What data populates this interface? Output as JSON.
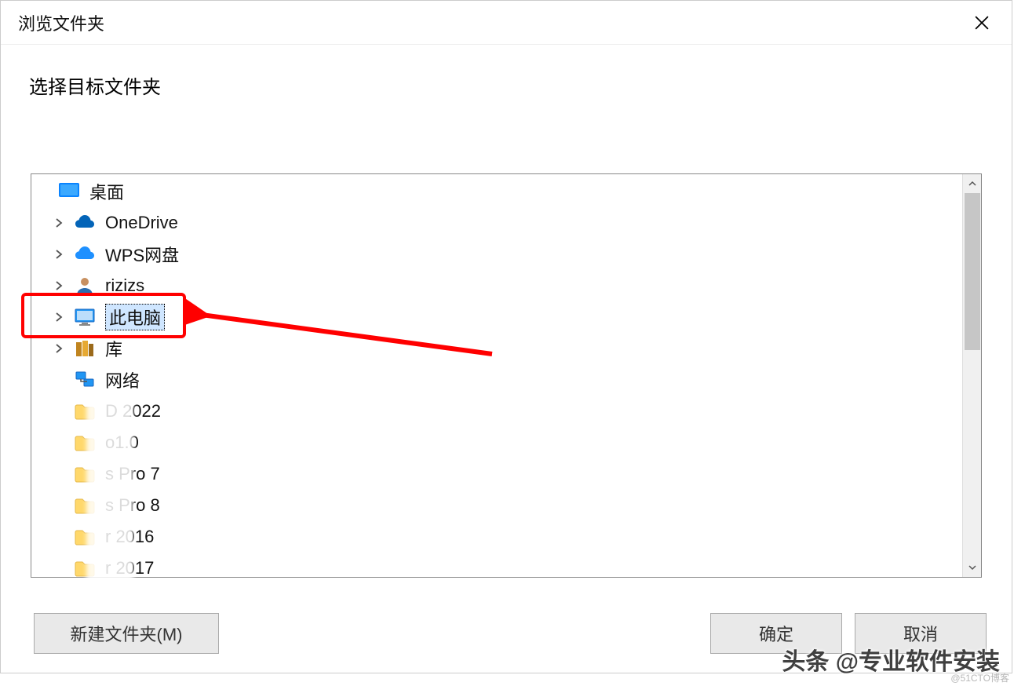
{
  "dialog": {
    "title": "浏览文件夹",
    "instruction": "选择目标文件夹"
  },
  "tree": {
    "items": [
      {
        "label": "桌面",
        "icon": "desktop-blue",
        "level": 0,
        "expandable": false,
        "selected": false
      },
      {
        "label": "OneDrive",
        "icon": "onedrive",
        "level": 1,
        "expandable": true,
        "selected": false
      },
      {
        "label": "WPS网盘",
        "icon": "wps-cloud",
        "level": 1,
        "expandable": true,
        "selected": false
      },
      {
        "label": "rizizs",
        "icon": "user",
        "level": 1,
        "expandable": true,
        "selected": false
      },
      {
        "label": "此电脑",
        "icon": "this-pc",
        "level": 1,
        "expandable": true,
        "selected": true
      },
      {
        "label": "库",
        "icon": "libraries",
        "level": 1,
        "expandable": true,
        "selected": false
      },
      {
        "label": "网络",
        "icon": "network",
        "level": 1,
        "expandable": false,
        "selected": false
      },
      {
        "label": "D 2022",
        "icon": "folder",
        "level": 1,
        "expandable": false,
        "selected": false,
        "blurred": true
      },
      {
        "label": "o1.0",
        "icon": "folder",
        "level": 1,
        "expandable": false,
        "selected": false,
        "blurred": true
      },
      {
        "label": "s Pro 7",
        "icon": "folder",
        "level": 1,
        "expandable": false,
        "selected": false,
        "blurred": true
      },
      {
        "label": "s Pro 8",
        "icon": "folder",
        "level": 1,
        "expandable": false,
        "selected": false,
        "blurred": true
      },
      {
        "label": "r 2016",
        "icon": "folder",
        "level": 1,
        "expandable": false,
        "selected": false,
        "blurred": true
      },
      {
        "label": "r 2017",
        "icon": "folder",
        "level": 1,
        "expandable": false,
        "selected": false,
        "blurred": true
      }
    ]
  },
  "buttons": {
    "new_folder": "新建文件夹(M)",
    "ok": "确定",
    "cancel": "取消"
  },
  "watermarks": {
    "main": "头条 @专业软件安装",
    "corner": "@51CTO博客"
  },
  "icons": {
    "close": "close-icon",
    "chevron": "chevron-right-icon"
  }
}
